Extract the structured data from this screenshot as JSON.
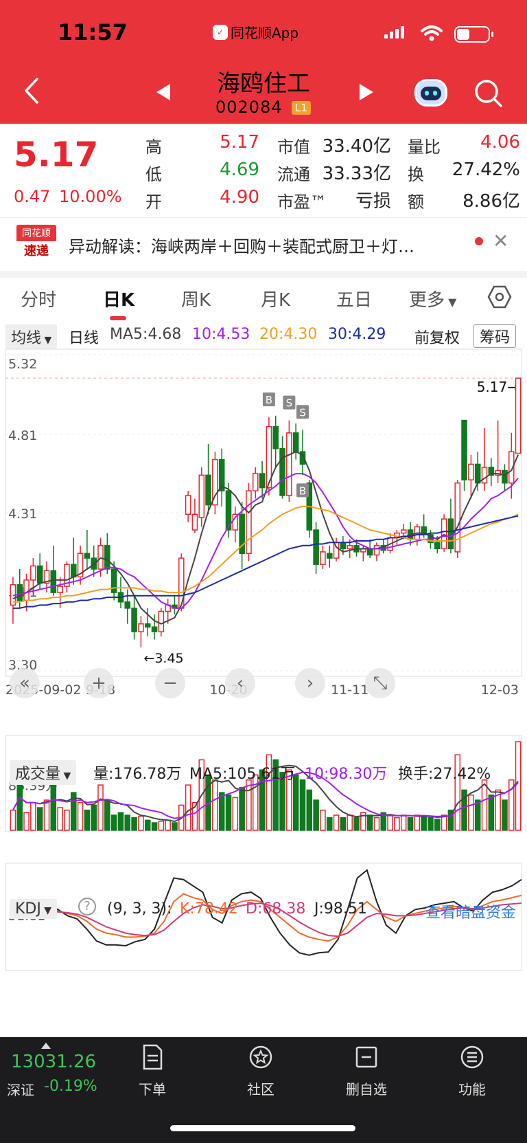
{
  "status": {
    "time": "11:57",
    "app": "同花顺App"
  },
  "header": {
    "name": "海鸥住工",
    "code": "002084",
    "level": "L1"
  },
  "quote": {
    "price": "5.17",
    "change": "0.47",
    "change_pct": "10.00%",
    "high_label": "高",
    "high": "5.17",
    "low_label": "低",
    "low": "4.69",
    "open_label": "开",
    "open": "4.90",
    "mcap_label": "市值",
    "mcap": "33.40亿",
    "float_label": "流通",
    "float": "33.33亿",
    "pe_label": "市盈™",
    "pe": "亏损",
    "vr_label": "量比",
    "vr": "4.06",
    "turn_label": "换",
    "turn": "27.42%",
    "amt_label": "额",
    "amt": "8.86亿"
  },
  "news": {
    "badge_top": "同花顺",
    "badge_bot": "速递",
    "text": "异动解读：海峡两岸＋回购＋装配式厨卫＋灯…"
  },
  "tabs": [
    "分时",
    "日K",
    "周K",
    "月K",
    "五日",
    "更多"
  ],
  "ma": {
    "selector": "均线",
    "period": "日线",
    "ma5": "MA5:4.68",
    "ma10": "10:4.53",
    "ma20": "20:4.30",
    "ma30": "30:4.29",
    "adjust": "前复权",
    "chips": "筹码"
  },
  "colors": {
    "up": "#e8262f",
    "down": "#0f7a1f",
    "ma5": "#444444",
    "ma10": "#a020f0",
    "ma20": "#f0a020",
    "ma30": "#1a2ca0"
  },
  "chart_data": {
    "type": "candlestick",
    "ylim": [
      3.3,
      5.32
    ],
    "y_labels": [
      "5.32",
      "4.81",
      "4.31",
      "3.81",
      "3.30"
    ],
    "x_labels": [
      "2025-09-02",
      "9-18",
      "10-20",
      "11-11",
      "12-03"
    ],
    "last_price_marker": "5.17→",
    "low_marker": "←3.45",
    "candles": [
      {
        "o": 3.72,
        "h": 3.9,
        "l": 3.6,
        "c": 3.85
      },
      {
        "o": 3.85,
        "h": 3.95,
        "l": 3.7,
        "c": 3.75
      },
      {
        "o": 3.75,
        "h": 3.92,
        "l": 3.68,
        "c": 3.88
      },
      {
        "o": 3.88,
        "h": 4.02,
        "l": 3.8,
        "c": 3.97
      },
      {
        "o": 3.97,
        "h": 4.05,
        "l": 3.82,
        "c": 3.86
      },
      {
        "o": 3.86,
        "h": 4.0,
        "l": 3.8,
        "c": 3.94
      },
      {
        "o": 3.94,
        "h": 4.1,
        "l": 3.78,
        "c": 3.8
      },
      {
        "o": 3.8,
        "h": 3.9,
        "l": 3.7,
        "c": 3.84
      },
      {
        "o": 3.84,
        "h": 4.0,
        "l": 3.8,
        "c": 3.98
      },
      {
        "o": 3.98,
        "h": 4.15,
        "l": 3.85,
        "c": 3.9
      },
      {
        "o": 3.9,
        "h": 4.1,
        "l": 3.85,
        "c": 4.05
      },
      {
        "o": 4.05,
        "h": 4.2,
        "l": 3.95,
        "c": 4.02
      },
      {
        "o": 4.02,
        "h": 4.1,
        "l": 3.9,
        "c": 3.95
      },
      {
        "o": 3.95,
        "h": 4.15,
        "l": 3.9,
        "c": 4.1
      },
      {
        "o": 4.1,
        "h": 4.18,
        "l": 3.92,
        "c": 3.95
      },
      {
        "o": 3.95,
        "h": 4.0,
        "l": 3.75,
        "c": 3.8
      },
      {
        "o": 3.8,
        "h": 3.9,
        "l": 3.7,
        "c": 3.74
      },
      {
        "o": 3.74,
        "h": 3.82,
        "l": 3.6,
        "c": 3.7
      },
      {
        "o": 3.7,
        "h": 3.78,
        "l": 3.5,
        "c": 3.55
      },
      {
        "o": 3.55,
        "h": 3.65,
        "l": 3.45,
        "c": 3.6
      },
      {
        "o": 3.6,
        "h": 3.7,
        "l": 3.52,
        "c": 3.58
      },
      {
        "o": 3.58,
        "h": 3.66,
        "l": 3.5,
        "c": 3.55
      },
      {
        "o": 3.55,
        "h": 3.7,
        "l": 3.52,
        "c": 3.68
      },
      {
        "o": 3.68,
        "h": 3.76,
        "l": 3.6,
        "c": 3.72
      },
      {
        "o": 3.72,
        "h": 3.78,
        "l": 3.66,
        "c": 3.7
      },
      {
        "o": 3.7,
        "h": 4.05,
        "l": 3.68,
        "c": 4.02
      },
      {
        "o": 4.3,
        "h": 4.45,
        "l": 4.25,
        "c": 4.42
      },
      {
        "o": 4.2,
        "h": 4.4,
        "l": 4.18,
        "c": 4.3
      },
      {
        "o": 4.28,
        "h": 4.6,
        "l": 4.22,
        "c": 4.55
      },
      {
        "o": 4.55,
        "h": 4.75,
        "l": 4.3,
        "c": 4.36
      },
      {
        "o": 4.36,
        "h": 4.7,
        "l": 4.3,
        "c": 4.65
      },
      {
        "o": 4.65,
        "h": 4.72,
        "l": 4.35,
        "c": 4.45
      },
      {
        "o": 4.45,
        "h": 4.5,
        "l": 4.15,
        "c": 4.2
      },
      {
        "o": 4.2,
        "h": 4.35,
        "l": 4.12,
        "c": 4.3
      },
      {
        "o": 4.3,
        "h": 4.38,
        "l": 3.95,
        "c": 4.05
      },
      {
        "o": 4.05,
        "h": 4.5,
        "l": 4.0,
        "c": 4.45
      },
      {
        "o": 4.45,
        "h": 4.6,
        "l": 4.4,
        "c": 4.56
      },
      {
        "o": 4.56,
        "h": 4.64,
        "l": 4.4,
        "c": 4.47
      },
      {
        "o": 4.47,
        "h": 4.92,
        "l": 4.42,
        "c": 4.86
      },
      {
        "o": 4.86,
        "h": 4.93,
        "l": 4.6,
        "c": 4.72
      },
      {
        "o": 4.72,
        "h": 4.8,
        "l": 4.4,
        "c": 4.42
      },
      {
        "o": 4.42,
        "h": 4.9,
        "l": 4.38,
        "c": 4.82
      },
      {
        "o": 4.82,
        "h": 4.88,
        "l": 4.65,
        "c": 4.7
      },
      {
        "o": 4.7,
        "h": 4.84,
        "l": 4.55,
        "c": 4.62
      },
      {
        "o": 4.5,
        "h": 4.52,
        "l": 4.15,
        "c": 4.2
      },
      {
        "o": 4.2,
        "h": 4.25,
        "l": 3.92,
        "c": 3.98
      },
      {
        "o": 3.98,
        "h": 4.1,
        "l": 3.95,
        "c": 4.06
      },
      {
        "o": 4.05,
        "h": 4.1,
        "l": 3.96,
        "c": 4.02
      },
      {
        "o": 4.02,
        "h": 4.15,
        "l": 4.0,
        "c": 4.12
      },
      {
        "o": 4.12,
        "h": 4.16,
        "l": 4.04,
        "c": 4.08
      },
      {
        "o": 4.08,
        "h": 4.14,
        "l": 4.02,
        "c": 4.1
      },
      {
        "o": 4.1,
        "h": 4.14,
        "l": 4.03,
        "c": 4.06
      },
      {
        "o": 4.06,
        "h": 4.1,
        "l": 4.0,
        "c": 4.08
      },
      {
        "o": 4.08,
        "h": 4.14,
        "l": 4.02,
        "c": 4.04
      },
      {
        "o": 4.04,
        "h": 4.12,
        "l": 4.0,
        "c": 4.1
      },
      {
        "o": 4.1,
        "h": 4.14,
        "l": 4.05,
        "c": 4.07
      },
      {
        "o": 4.07,
        "h": 4.18,
        "l": 4.05,
        "c": 4.15
      },
      {
        "o": 4.15,
        "h": 4.2,
        "l": 4.1,
        "c": 4.18
      },
      {
        "o": 4.18,
        "h": 4.24,
        "l": 4.14,
        "c": 4.2
      },
      {
        "o": 4.2,
        "h": 4.25,
        "l": 4.1,
        "c": 4.14
      },
      {
        "o": 4.14,
        "h": 4.24,
        "l": 4.1,
        "c": 4.22
      },
      {
        "o": 4.22,
        "h": 4.3,
        "l": 4.15,
        "c": 4.17
      },
      {
        "o": 4.17,
        "h": 4.2,
        "l": 4.08,
        "c": 4.12
      },
      {
        "o": 4.12,
        "h": 4.16,
        "l": 4.05,
        "c": 4.08
      },
      {
        "o": 4.08,
        "h": 4.3,
        "l": 4.06,
        "c": 4.27
      },
      {
        "o": 4.27,
        "h": 4.4,
        "l": 4.05,
        "c": 4.08
      },
      {
        "o": 4.06,
        "h": 4.52,
        "l": 4.02,
        "c": 4.5
      },
      {
        "o": 4.9,
        "h": 4.9,
        "l": 4.45,
        "c": 4.52
      },
      {
        "o": 4.52,
        "h": 4.68,
        "l": 4.4,
        "c": 4.62
      },
      {
        "o": 4.62,
        "h": 4.7,
        "l": 4.45,
        "c": 4.5
      },
      {
        "o": 4.5,
        "h": 4.85,
        "l": 4.45,
        "c": 4.6
      },
      {
        "o": 4.6,
        "h": 4.66,
        "l": 4.48,
        "c": 4.55
      },
      {
        "o": 4.55,
        "h": 4.9,
        "l": 4.5,
        "c": 4.58
      },
      {
        "o": 4.58,
        "h": 4.62,
        "l": 4.45,
        "c": 4.5
      },
      {
        "o": 4.5,
        "h": 4.82,
        "l": 4.4,
        "c": 4.7
      },
      {
        "o": 4.69,
        "h": 5.17,
        "l": 4.69,
        "c": 5.17
      }
    ],
    "ma_series": {
      "MA5": [
        3.76,
        3.78,
        3.8,
        3.83,
        3.86,
        3.87,
        3.88,
        3.88,
        3.88,
        3.9,
        3.92,
        3.95,
        3.98,
        4.02,
        4.01,
        3.97,
        3.92,
        3.86,
        3.78,
        3.7,
        3.66,
        3.62,
        3.6,
        3.62,
        3.64,
        3.72,
        3.88,
        4.02,
        4.18,
        4.32,
        4.42,
        4.48,
        4.46,
        4.42,
        4.35,
        4.31,
        4.36,
        4.38,
        4.5,
        4.6,
        4.66,
        4.68,
        4.7,
        4.68,
        4.58,
        4.44,
        4.3,
        4.18,
        4.09,
        4.06,
        4.07,
        4.08,
        4.08,
        4.08,
        4.08,
        4.09,
        4.11,
        4.13,
        4.15,
        4.17,
        4.18,
        4.18,
        4.16,
        4.14,
        4.17,
        4.15,
        4.22,
        4.32,
        4.41,
        4.5,
        4.53,
        4.56,
        4.56,
        4.55,
        4.58,
        4.68
      ],
      "MA10": [
        3.78,
        3.79,
        3.8,
        3.81,
        3.82,
        3.83,
        3.84,
        3.85,
        3.86,
        3.87,
        3.88,
        3.9,
        3.92,
        3.94,
        3.96,
        3.96,
        3.95,
        3.92,
        3.9,
        3.86,
        3.82,
        3.78,
        3.74,
        3.72,
        3.7,
        3.7,
        3.74,
        3.8,
        3.88,
        3.97,
        4.06,
        4.15,
        4.22,
        4.28,
        4.32,
        4.36,
        4.39,
        4.42,
        4.45,
        4.48,
        4.52,
        4.54,
        4.56,
        4.56,
        4.54,
        4.5,
        4.44,
        4.37,
        4.3,
        4.22,
        4.16,
        4.12,
        4.1,
        4.08,
        4.08,
        4.08,
        4.09,
        4.1,
        4.11,
        4.12,
        4.13,
        4.14,
        4.14,
        4.15,
        4.16,
        4.16,
        4.18,
        4.22,
        4.27,
        4.31,
        4.35,
        4.4,
        4.42,
        4.45,
        4.48,
        4.53
      ],
      "MA20": [
        3.74,
        3.74,
        3.75,
        3.75,
        3.76,
        3.76,
        3.77,
        3.77,
        3.78,
        3.78,
        3.79,
        3.8,
        3.81,
        3.82,
        3.82,
        3.83,
        3.83,
        3.83,
        3.83,
        3.82,
        3.82,
        3.81,
        3.81,
        3.8,
        3.8,
        3.8,
        3.82,
        3.84,
        3.87,
        3.9,
        3.94,
        3.98,
        4.02,
        4.06,
        4.1,
        4.14,
        4.17,
        4.2,
        4.24,
        4.27,
        4.3,
        4.32,
        4.34,
        4.35,
        4.35,
        4.34,
        4.33,
        4.32,
        4.3,
        4.28,
        4.26,
        4.24,
        4.22,
        4.2,
        4.19,
        4.18,
        4.17,
        4.16,
        4.15,
        4.14,
        4.14,
        4.14,
        4.13,
        4.13,
        4.13,
        4.13,
        4.14,
        4.16,
        4.18,
        4.2,
        4.22,
        4.24,
        4.25,
        4.27,
        4.28,
        4.3
      ],
      "MA30": [
        3.7,
        3.7,
        3.71,
        3.71,
        3.72,
        3.72,
        3.73,
        3.73,
        3.74,
        3.74,
        3.75,
        3.75,
        3.76,
        3.76,
        3.77,
        3.77,
        3.77,
        3.78,
        3.78,
        3.78,
        3.78,
        3.78,
        3.78,
        3.78,
        3.78,
        3.78,
        3.79,
        3.8,
        3.82,
        3.84,
        3.86,
        3.88,
        3.9,
        3.92,
        3.94,
        3.96,
        3.98,
        4.0,
        4.02,
        4.04,
        4.06,
        4.08,
        4.09,
        4.1,
        4.1,
        4.11,
        4.11,
        4.12,
        4.12,
        4.12,
        4.12,
        4.13,
        4.13,
        4.13,
        4.14,
        4.14,
        4.15,
        4.15,
        4.16,
        4.16,
        4.17,
        4.17,
        4.18,
        4.18,
        4.19,
        4.19,
        4.2,
        4.21,
        4.22,
        4.23,
        4.24,
        4.25,
        4.26,
        4.27,
        4.28,
        4.29
      ]
    },
    "signals": [
      {
        "label": "B"
      },
      {
        "label": "S"
      },
      {
        "label": "S"
      },
      {
        "label": "B"
      }
    ],
    "volume": {
      "selector": "成交量",
      "vol": "量:176.78万",
      "ma5": "MA5:105.61万",
      "ma10": "10:98.30万",
      "turnover": "换手:27.42%",
      "ylabel": "88.39万",
      "values": [
        40,
        90,
        35,
        55,
        45,
        60,
        100,
        45,
        40,
        75,
        55,
        40,
        50,
        90,
        60,
        30,
        35,
        30,
        25,
        28,
        20,
        15,
        18,
        20,
        15,
        50,
        90,
        55,
        140,
        110,
        100,
        75,
        70,
        65,
        85,
        100,
        110,
        120,
        150,
        140,
        115,
        120,
        110,
        100,
        80,
        60,
        40,
        25,
        30,
        25,
        30,
        25,
        35,
        30,
        25,
        35,
        30,
        25,
        30,
        25,
        30,
        28,
        25,
        22,
        30,
        40,
        150,
        80,
        70,
        60,
        100,
        70,
        80,
        60,
        100,
        176
      ]
    },
    "kdj": {
      "selector": "KDJ",
      "params": "(9, 3, 3):",
      "k": "K:78.42",
      "d": "D:68.38",
      "j": "J:98.51",
      "link": "查看暗盘资金",
      "ylabel": "51.81",
      "K": [
        55,
        60,
        58,
        62,
        60,
        58,
        55,
        52,
        45,
        35,
        30,
        28,
        25,
        25,
        26,
        30,
        45,
        70,
        80,
        75,
        72,
        60,
        55,
        65,
        70,
        72,
        70,
        60,
        50,
        40,
        30,
        25,
        22,
        20,
        25,
        40,
        60,
        70,
        60,
        50,
        45,
        52,
        55,
        58,
        60,
        62,
        64,
        62,
        60,
        65,
        70,
        72,
        75,
        78
      ],
      "D": [
        55,
        57,
        57,
        58,
        58,
        57,
        56,
        54,
        50,
        44,
        38,
        34,
        30,
        28,
        27,
        28,
        34,
        45,
        55,
        62,
        66,
        64,
        61,
        62,
        65,
        67,
        68,
        65,
        60,
        52,
        44,
        37,
        31,
        27,
        26,
        30,
        40,
        50,
        55,
        54,
        52,
        52,
        53,
        55,
        57,
        59,
        61,
        62,
        61,
        62,
        64,
        66,
        67,
        68
      ],
      "J": [
        55,
        65,
        60,
        70,
        65,
        60,
        52,
        48,
        35,
        20,
        15,
        15,
        14,
        19,
        22,
        35,
        68,
        100,
        98,
        90,
        82,
        50,
        43,
        72,
        80,
        82,
        74,
        50,
        30,
        15,
        5,
        2,
        5,
        6,
        22,
        60,
        100,
        110,
        70,
        40,
        30,
        52,
        60,
        62,
        66,
        68,
        70,
        62,
        58,
        72,
        82,
        85,
        90,
        98
      ]
    }
  },
  "bottom": {
    "index_value": "13031.26",
    "index_name": "深证",
    "index_change": "-0.19%",
    "nav": [
      "下单",
      "社区",
      "删自选",
      "功能"
    ]
  }
}
